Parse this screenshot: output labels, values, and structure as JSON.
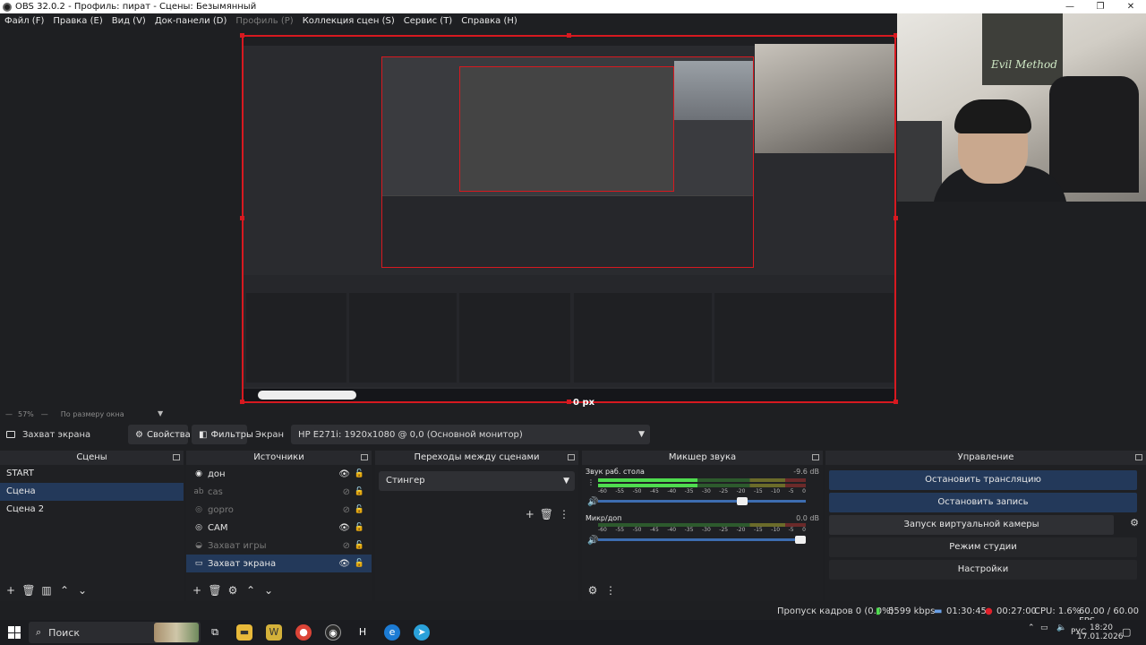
{
  "window": {
    "title": "OBS 32.0.2 - Профиль: пират - Сцены: Безымянный",
    "controls": [
      "—",
      "❐",
      "✕"
    ]
  },
  "menu": [
    "Файл (F)",
    "Правка (E)",
    "Вид (V)",
    "Док-панели (D)",
    "Профиль (P)",
    "Коллекция сцен (S)",
    "Сервис (T)",
    "Справка (H)"
  ],
  "preview": {
    "px_label": "0 px",
    "zoom": "57%",
    "zoom_mode": "По размеру окна",
    "webcam_caption": "Evil Method"
  },
  "source_toolbar": {
    "source_name": "Захват экрана",
    "properties_label": "Свойства",
    "filters_label": "Фильтры",
    "screen_label": "Экран",
    "monitor_value": "HP E271i: 1920x1080 @ 0,0 (Основной монитор)"
  },
  "docks": {
    "scenes": {
      "title": "Сцены",
      "items": [
        {
          "label": "START"
        },
        {
          "label": "Сцена"
        },
        {
          "label": "Сцена 2"
        }
      ]
    },
    "sources": {
      "title": "Источники",
      "items": [
        {
          "label": "дон",
          "icon": "audio-icon"
        },
        {
          "label": "cas",
          "icon": "text-icon"
        },
        {
          "label": "gopro",
          "icon": "camera-icon"
        },
        {
          "label": "CAM",
          "icon": "camera-icon"
        },
        {
          "label": "Захват игры",
          "icon": "gamepad-icon"
        },
        {
          "label": "Захват экрана",
          "icon": "monitor-icon"
        }
      ]
    },
    "transitions": {
      "title": "Переходы между сценами",
      "selected": "Стингер"
    },
    "mixer": {
      "title": "Микшер звука",
      "channels": [
        {
          "name": "Звук раб. стола",
          "db": "-9.6 dB",
          "level": 0.48,
          "volume": 0.72
        },
        {
          "name": "Микр/доп",
          "db": "0.0 dB",
          "level": 0,
          "volume": 1.0
        }
      ],
      "ticks": [
        "-60",
        "-55",
        "-50",
        "-45",
        "-40",
        "-35",
        "-30",
        "-25",
        "-20",
        "-15",
        "-10",
        "-5",
        "0"
      ]
    },
    "controls": {
      "title": "Управление",
      "buttons": [
        "Остановить трансляцию",
        "Остановить запись",
        "Запуск виртуальной камеры",
        "Режим студии",
        "Настройки"
      ]
    }
  },
  "status": {
    "dropped_frames": "Пропуск кадров 0 (0.0%)",
    "bitrate": "5599 kbps",
    "stream_time": "01:30:45",
    "rec_time": "00:27:00",
    "cpu": "CPU: 1.6%",
    "fps": "60.00 / 60.00 FPS"
  },
  "taskbar": {
    "search_placeholder": "Поиск",
    "lang": "РУС",
    "time": "18:20",
    "date": "17.01.2026"
  },
  "colors": {
    "accent": "#23395a",
    "selection_border": "#d71920",
    "meter_green": "#4fdc4f"
  }
}
